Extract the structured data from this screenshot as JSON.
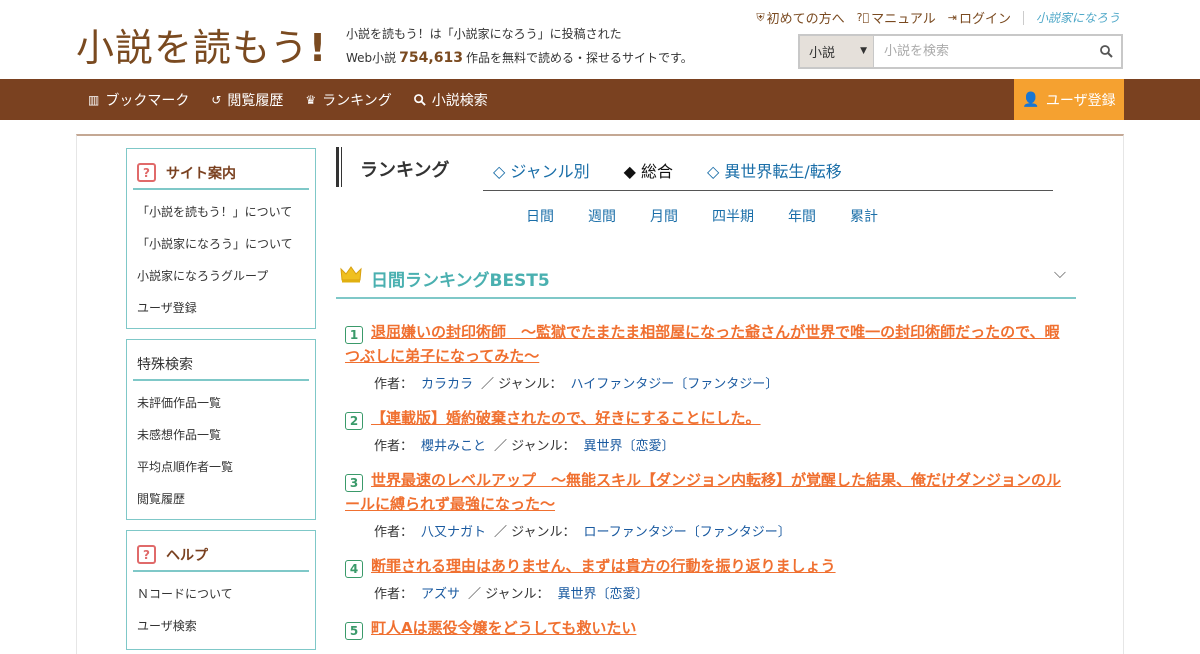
{
  "header": {
    "logo": "小説を読もう",
    "logo_excl": "!",
    "tagline_1": "小説を読もう！は「小説家になろう」に投稿された",
    "tagline_2a": "Web小説",
    "tagline_count": "754,613",
    "tagline_2b": "作品を無料で読める・探せるサイトです。",
    "links": {
      "beginner": "初めての方へ",
      "manual": "マニュアル",
      "login": "ログイン",
      "narou": "小説家になろう"
    },
    "search": {
      "select_value": "小説",
      "placeholder": "小説を検索"
    }
  },
  "nav": {
    "bookmark": "ブックマーク",
    "history": "閲覧履歴",
    "ranking": "ランキング",
    "search": "小説検索",
    "register": "ユーザ登録"
  },
  "sidebar": {
    "site_guide": {
      "title": "サイト案内",
      "items": [
        "「小説を読もう！」について",
        "「小説家になろう」について",
        "小説家になろうグループ",
        "ユーザ登録"
      ]
    },
    "special_search": {
      "title": "特殊検索",
      "items": [
        "未評価作品一覧",
        "未感想作品一覧",
        "平均点順作者一覧",
        "閲覧履歴"
      ]
    },
    "help": {
      "title": "ヘルプ",
      "items": [
        "Ｎコードについて",
        "ユーザ検索"
      ]
    }
  },
  "ranking": {
    "title": "ランキング",
    "tabs": [
      "◇ ジャンル別",
      "◆ 総合",
      "◇ 異世界転生/転移"
    ],
    "periods": [
      "日間",
      "週間",
      "月間",
      "四半期",
      "年間",
      "累計"
    ],
    "best_title": "日間ランキングBEST5",
    "labels": {
      "author": "作者：",
      "genre": "／ ジャンル："
    },
    "entries": [
      {
        "rank": "1",
        "title": "退屈嫌いの封印術師　～監獄でたまたま相部屋になった爺さんが世界で唯一の封印術師だったので、暇つぶしに弟子になってみた～",
        "author": "カラカラ",
        "genre": "ハイファンタジー〔ファンタジー〕"
      },
      {
        "rank": "2",
        "title": "【連載版】婚約破棄されたので、好きにすることにした。",
        "author": "櫻井みこと",
        "genre": "異世界〔恋愛〕"
      },
      {
        "rank": "3",
        "title": "世界最速のレベルアップ　～無能スキル【ダンジョン内転移】が覚醒した結果、俺だけダンジョンのルールに縛られず最強になった～",
        "author": "八又ナガト",
        "genre": "ローファンタジー〔ファンタジー〕"
      },
      {
        "rank": "4",
        "title": "断罪される理由はありません、まずは貴方の行動を振り返りましょう",
        "author": "アズサ",
        "genre": "異世界〔恋愛〕"
      },
      {
        "rank": "5",
        "title": "町人Aは悪役令嬢をどうしても救いたい",
        "author": "",
        "genre": ""
      }
    ]
  }
}
